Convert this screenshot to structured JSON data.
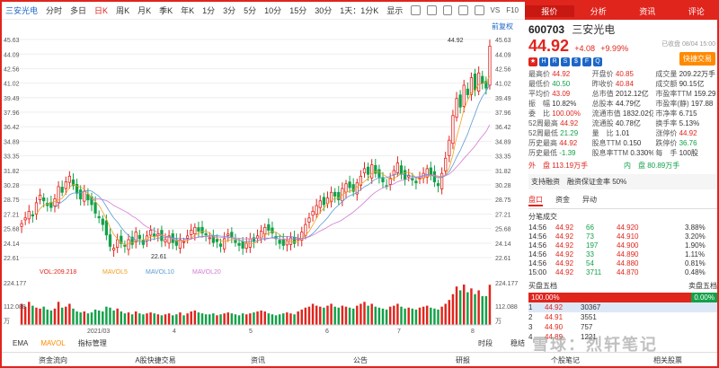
{
  "toolbar": {
    "stock": "三安光电",
    "items": [
      "分时",
      "多日",
      "日K",
      "周K",
      "月K",
      "季K",
      "年K",
      "1分",
      "3分",
      "5分",
      "10分",
      "15分",
      "30分"
    ],
    "active": "日K",
    "adjust": "1天：1分K",
    "display": "显示"
  },
  "right_tabs": [
    "报价",
    "分析",
    "资讯",
    "评论"
  ],
  "right_active": "报价",
  "quote": {
    "code": "600703",
    "name": "三安光电",
    "price": "44.92",
    "change": "+4.08",
    "pct": "+9.99%",
    "status": "已收盘 08/04 15:00",
    "follow": "快捷交易",
    "rows": [
      [
        "最高价",
        "44.92",
        "开盘价",
        "40.85",
        "成交量",
        "209.22万手"
      ],
      [
        "最低价",
        "40.50",
        "昨收价",
        "40.84",
        "成交额",
        "90.15亿"
      ],
      [
        "平均价",
        "43.09",
        "总市值",
        "2012.12亿",
        "市盈率TTM",
        "159.29"
      ],
      [
        "振　幅",
        "10.82%",
        "总股本",
        "44.79亿",
        "市盈率(静)",
        "197.88"
      ],
      [
        "委　比",
        "100.00%",
        "流通市值",
        "1832.02亿",
        "市净率",
        "6.715"
      ],
      [
        "52周最高",
        "44.92",
        "流通股",
        "40.78亿",
        "换手率",
        "5.13%"
      ],
      [
        "52周最低",
        "21.29",
        "量　比",
        "1.01",
        "涨停价",
        "44.92"
      ],
      [
        "历史最高",
        "44.92",
        "股息TTM",
        "0.150",
        "跌停价",
        "36.76"
      ],
      [
        "历史最低",
        "-1.39",
        "股息率TTM",
        "0.330%",
        "每　手",
        "100股"
      ]
    ],
    "outer": "外　盘 113.19万手",
    "inner": "内　盘 80.89万手",
    "margin": "支持融资　融资保证金率 50%",
    "subtabs": [
      "盘口",
      "资金",
      "异动"
    ],
    "ticks_title": "分笔成交",
    "ticks": [
      [
        "14:56",
        "44.92",
        "66",
        "44.920",
        "3.88%"
      ],
      [
        "14:56",
        "44.92",
        "73",
        "44.910",
        "3.20%"
      ],
      [
        "14:56",
        "44.92",
        "197",
        "44.900",
        "1.90%"
      ],
      [
        "14:56",
        "44.92",
        "33",
        "44.890",
        "1.11%"
      ],
      [
        "14:56",
        "44.92",
        "54",
        "44.880",
        "0.81%"
      ],
      [
        "15:00",
        "44.92",
        "3711",
        "44.870",
        "0.48%"
      ]
    ],
    "book_buy": "买盘五档",
    "book_sell": "卖盘五档",
    "pct_left": "100.00%",
    "pct_right": "0.00%",
    "book": [
      [
        "1",
        "44.92",
        "30367"
      ],
      [
        "2",
        "44.91",
        "3551"
      ],
      [
        "3",
        "44.90",
        "757"
      ],
      [
        "4",
        "44.89",
        "1221"
      ]
    ]
  },
  "chart_labels": {
    "high": "44.92",
    "low": "22.61",
    "title": "前复权",
    "mavol": "VOL:209.218"
  },
  "mavol_legend": [
    "MAVOL5",
    "MAVOL10",
    "MAVOL20"
  ],
  "y_axis": [
    "45.63",
    "44.09",
    "42.56",
    "41.02",
    "39.49",
    "37.96",
    "36.42",
    "34.89",
    "33.35",
    "31.82",
    "30.28",
    "28.75",
    "27.21",
    "25.68",
    "24.14",
    "22.61"
  ],
  "vol_axis": [
    "224.177",
    "112.088",
    "万"
  ],
  "x_axis": [
    "2021/03",
    "4",
    "5",
    "6",
    "7",
    "8"
  ],
  "bottom_tabs": [
    "EMA",
    "MAVOL",
    "指标管理"
  ],
  "bottom_right": [
    "时段",
    "稳结"
  ],
  "footer": [
    "资金流向",
    "A股快捷交易",
    "资讯",
    "公告",
    "研报",
    "个股笔记",
    "相关股票"
  ],
  "watermark": "雪球：烈轩笔记",
  "chart_data": {
    "type": "candlestick",
    "closes": [
      26.2,
      26.8,
      27.5,
      27.0,
      28.4,
      29.2,
      28.6,
      28.1,
      27.9,
      28.8,
      30.1,
      29.5,
      30.6,
      31.2,
      30.2,
      29.4,
      28.8,
      29.6,
      28.7,
      28.2,
      27.3,
      26.8,
      26.1,
      25.0,
      23.8,
      23.6,
      24.5,
      24.1,
      23.8,
      24.5,
      24.0,
      25.3,
      24.6,
      24.0,
      24.9,
      25.5,
      24.9,
      25.1,
      24.4,
      24.5,
      24.9,
      24.2,
      23.9,
      24.5,
      24.3,
      24.9,
      25.5,
      25.8,
      25.4,
      25.2,
      25.0,
      24.7,
      24.2,
      24.3,
      23.8,
      24.6,
      25.1,
      24.8,
      24.2,
      23.9,
      23.6,
      24.1,
      24.6,
      24.3,
      24.9,
      25.4,
      25.8,
      25.5,
      25.2,
      24.6,
      24.1,
      23.9,
      24.4,
      24.7,
      24.1,
      24.6,
      25.3,
      26.1,
      26.8,
      27.5,
      28.1,
      28.6,
      28.2,
      28.9,
      29.5,
      29.1,
      28.7,
      29.9,
      30.4,
      30.0,
      29.6,
      30.5,
      31.2,
      32.0,
      31.4,
      32.4,
      31.5,
      31.1,
      30.6,
      30.2,
      31.0,
      31.8,
      32.6,
      31.5,
      30.9,
      31.3,
      30.8,
      30.5,
      31.0,
      31.5,
      32.0,
      31.3,
      30.6,
      30.2,
      31.5,
      33.1,
      35.0,
      37.6,
      39.4,
      38.5,
      40.8,
      39.8,
      41.6,
      40.3,
      42.1,
      41.0,
      40.5,
      44.92
    ],
    "volumes": [
      110,
      95,
      120,
      100,
      90,
      85,
      95,
      80,
      75,
      85,
      120,
      90,
      95,
      110,
      85,
      70,
      65,
      70,
      60,
      65,
      80,
      75,
      70,
      95,
      90,
      75,
      85,
      70,
      60,
      65,
      55,
      70,
      60,
      55,
      60,
      65,
      60,
      55,
      50,
      55,
      60,
      50,
      55,
      65,
      50,
      60,
      70,
      75,
      65,
      60,
      55,
      55,
      60,
      50,
      55,
      60,
      65,
      60,
      55,
      50,
      60,
      55,
      60,
      65,
      70,
      75,
      70,
      60,
      55,
      50,
      55,
      60,
      65,
      60,
      55,
      70,
      80,
      90,
      95,
      110,
      100,
      95,
      90,
      100,
      110,
      95,
      90,
      100,
      95,
      90,
      85,
      100,
      110,
      120,
      100,
      110,
      95,
      90,
      85,
      80,
      95,
      100,
      110,
      95,
      85,
      90,
      85,
      80,
      90,
      95,
      100,
      90,
      85,
      80,
      95,
      110,
      130,
      160,
      200,
      180,
      210,
      170,
      190,
      160,
      180,
      150,
      150,
      209
    ]
  }
}
